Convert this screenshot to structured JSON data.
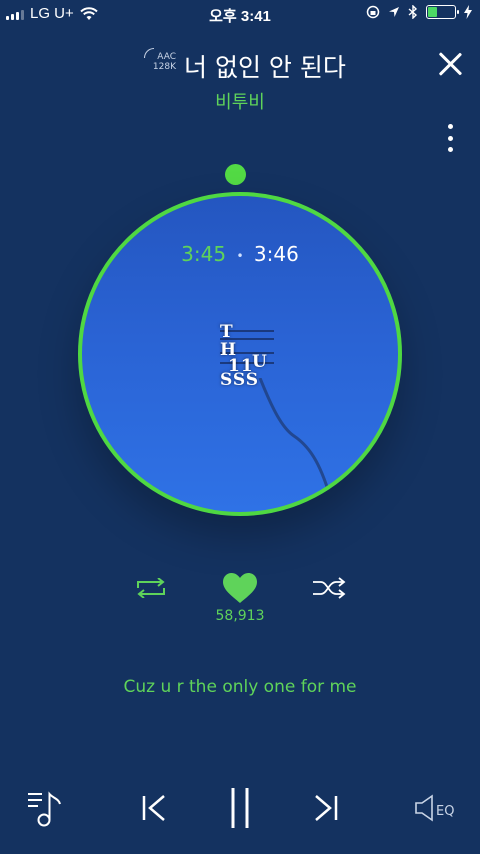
{
  "status_bar": {
    "carrier": "LG U+",
    "time": "오후 3:41"
  },
  "now_playing": {
    "codec_format": "AAC",
    "codec_bitrate": "128K",
    "title": "너 없인 안 된다",
    "artist": "비투비"
  },
  "player": {
    "current_time": "3:45",
    "separator": "•",
    "total_time": "3:46",
    "progress": 0.996,
    "album_art_text": [
      "T",
      "H",
      "11",
      "U",
      "SSS"
    ]
  },
  "actions": {
    "like_count": "58,913"
  },
  "lyrics": {
    "current_line": "Cuz u r the only one for me"
  },
  "bottom_bar": {
    "eq_label": "EQ"
  },
  "colors": {
    "background": "#143260",
    "accent_green": "#5fd35a",
    "disc_blue": "#2a63d4"
  },
  "icons": {
    "wifi": "wifi-icon",
    "location": "location-arrow-icon",
    "bluetooth": "bluetooth-icon",
    "repeat": "repeat-icon",
    "heart": "heart-icon",
    "shuffle": "shuffle-icon",
    "playlist": "playlist-icon",
    "previous": "previous-icon",
    "pause": "pause-icon",
    "next": "next-icon",
    "eq": "speaker-eq-icon"
  }
}
